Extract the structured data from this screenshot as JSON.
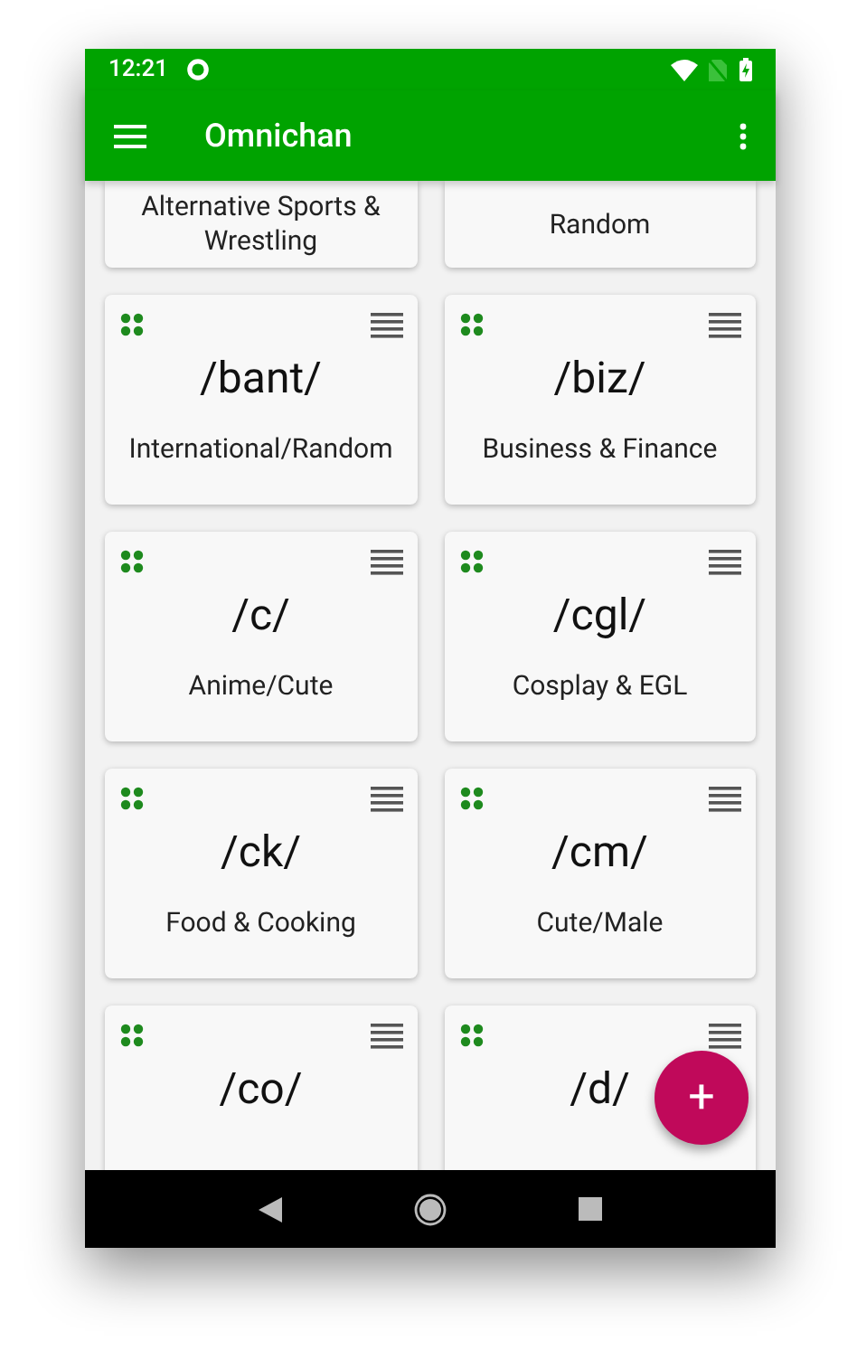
{
  "status_bar": {
    "time": "12:21"
  },
  "app_bar": {
    "title": "Omnichan"
  },
  "boards": [
    {
      "description": "Alternative Sports & Wrestling"
    },
    {
      "description": "Random"
    },
    {
      "name": "/bant/",
      "description": "International/Random"
    },
    {
      "name": "/biz/",
      "description": "Business & Finance"
    },
    {
      "name": "/c/",
      "description": "Anime/Cute"
    },
    {
      "name": "/cgl/",
      "description": "Cosplay & EGL"
    },
    {
      "name": "/ck/",
      "description": "Food & Cooking"
    },
    {
      "name": "/cm/",
      "description": "Cute/Male"
    },
    {
      "name": "/co/"
    },
    {
      "name": "/d/"
    }
  ],
  "fab": {
    "label": "+"
  }
}
